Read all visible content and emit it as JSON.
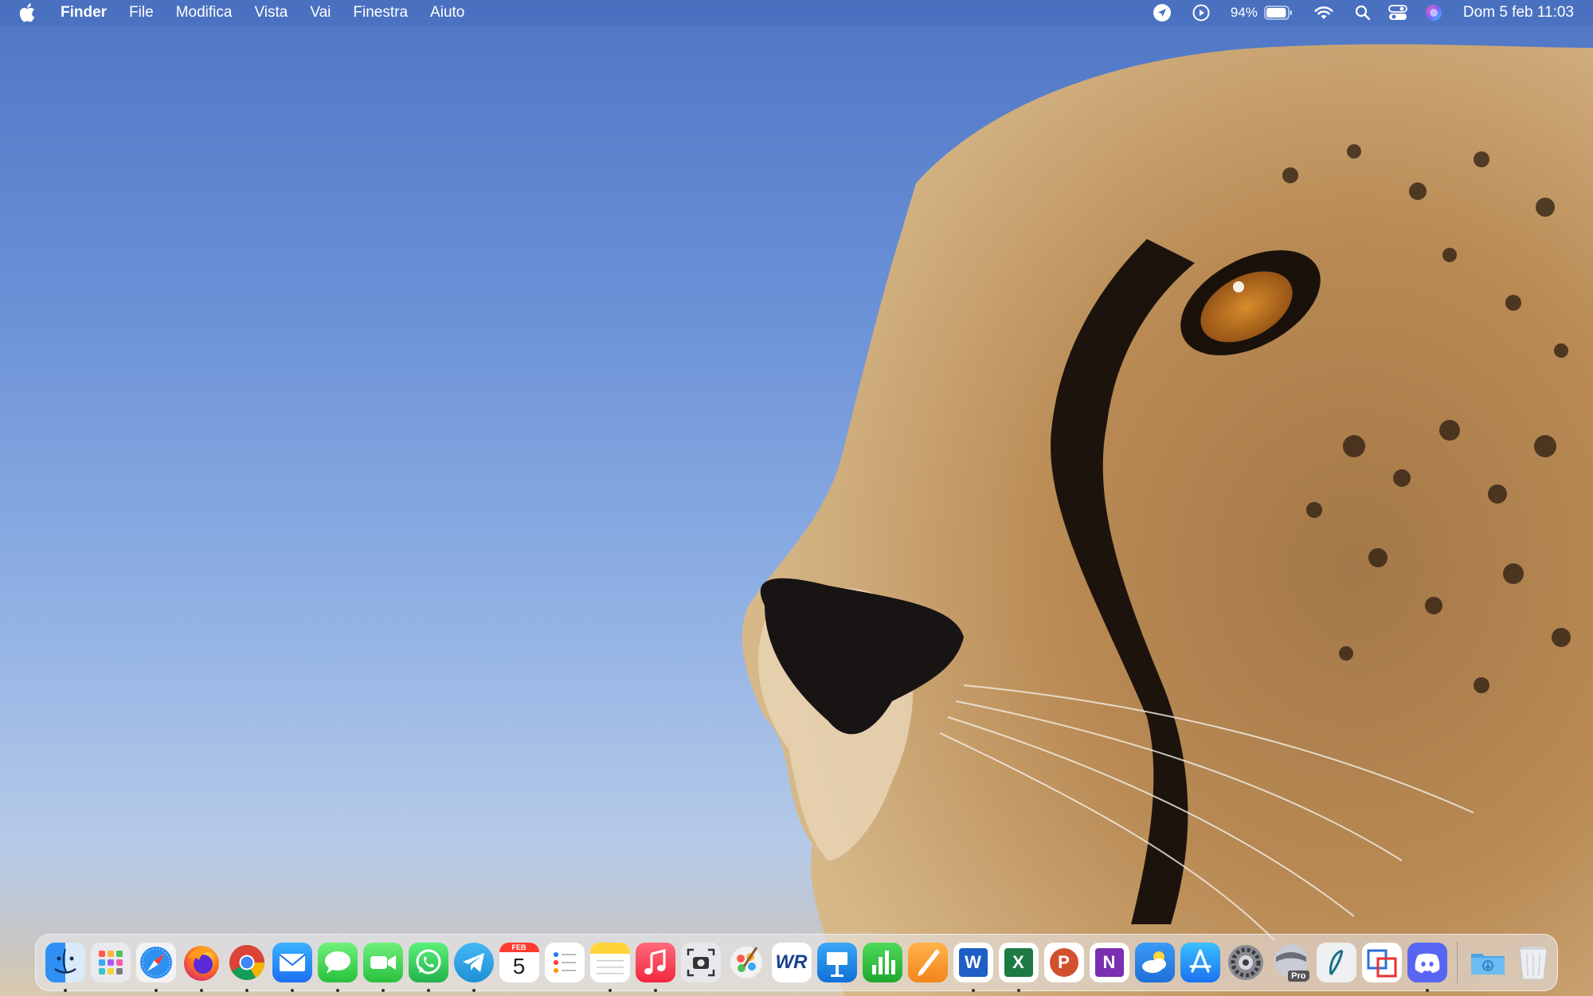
{
  "menubar": {
    "apple_icon": "apple-logo-icon",
    "app_name": "Finder",
    "menus": [
      "File",
      "Modifica",
      "Vista",
      "Vai",
      "Finestra",
      "Aiuto"
    ],
    "battery_percent": "94%",
    "battery_level": 0.94,
    "clock": "Dom 5 feb  11:03",
    "status_icons": [
      "location-icon",
      "play-circle-icon",
      "battery-icon",
      "wifi-icon",
      "spotlight-search-icon",
      "control-center-icon",
      "siri-icon"
    ]
  },
  "dock": {
    "apps": [
      {
        "name": "Finder",
        "icon": "finder-icon",
        "running": true
      },
      {
        "name": "Launchpad",
        "icon": "launchpad-icon",
        "running": false
      },
      {
        "name": "Safari",
        "icon": "safari-icon",
        "running": true
      },
      {
        "name": "Firefox",
        "icon": "firefox-icon",
        "running": true
      },
      {
        "name": "Chrome",
        "icon": "chrome-icon",
        "running": true
      },
      {
        "name": "Mail",
        "icon": "mail-icon",
        "running": true
      },
      {
        "name": "Messages",
        "icon": "messages-icon",
        "running": true
      },
      {
        "name": "FaceTime",
        "icon": "facetime-icon",
        "running": true
      },
      {
        "name": "WhatsApp",
        "icon": "whatsapp-icon",
        "running": true
      },
      {
        "name": "Telegram",
        "icon": "telegram-icon",
        "running": true
      },
      {
        "name": "Calendar",
        "icon": "calendar-icon",
        "running": false,
        "month": "FEB",
        "day": "5"
      },
      {
        "name": "Reminders",
        "icon": "reminders-icon",
        "running": false
      },
      {
        "name": "Notes",
        "icon": "notes-icon",
        "running": true
      },
      {
        "name": "Music",
        "icon": "music-icon",
        "running": true
      },
      {
        "name": "Screenshot",
        "icon": "screenshot-icon",
        "running": false
      },
      {
        "name": "Pixelmator",
        "icon": "pixelmator-icon",
        "running": false
      },
      {
        "name": "WordReference",
        "icon": "wordreference-icon",
        "running": false,
        "label": "WR"
      },
      {
        "name": "Keynote",
        "icon": "keynote-icon",
        "running": false
      },
      {
        "name": "Numbers",
        "icon": "numbers-icon",
        "running": false
      },
      {
        "name": "Pages",
        "icon": "pages-icon",
        "running": false
      },
      {
        "name": "Word",
        "icon": "word-icon",
        "running": true,
        "label": "W"
      },
      {
        "name": "Excel",
        "icon": "excel-icon",
        "running": true,
        "label": "X"
      },
      {
        "name": "PowerPoint",
        "icon": "powerpoint-icon",
        "running": false,
        "label": "P"
      },
      {
        "name": "OneNote",
        "icon": "onenote-icon",
        "running": false,
        "label": "N"
      },
      {
        "name": "Weather",
        "icon": "weather-icon",
        "running": false
      },
      {
        "name": "App Store",
        "icon": "app-store-icon",
        "running": false
      },
      {
        "name": "System Settings",
        "icon": "system-settings-icon",
        "running": false
      },
      {
        "name": "Compressor Pro",
        "icon": "pro-app-icon",
        "running": false,
        "label": "Pro"
      },
      {
        "name": "Scrivener",
        "icon": "scrivener-icon",
        "running": false
      },
      {
        "name": "Parallels",
        "icon": "parallels-icon",
        "running": false
      },
      {
        "name": "Discord",
        "icon": "discord-icon",
        "running": true
      }
    ],
    "extras": [
      {
        "name": "Downloads",
        "icon": "downloads-folder-icon"
      },
      {
        "name": "Trash",
        "icon": "trash-icon"
      }
    ]
  },
  "colors": {
    "menubar_bg": "#466ebe",
    "sky_top": "#4f76c4",
    "sky_bottom": "#b6cae8",
    "fur": "#b98a54"
  }
}
